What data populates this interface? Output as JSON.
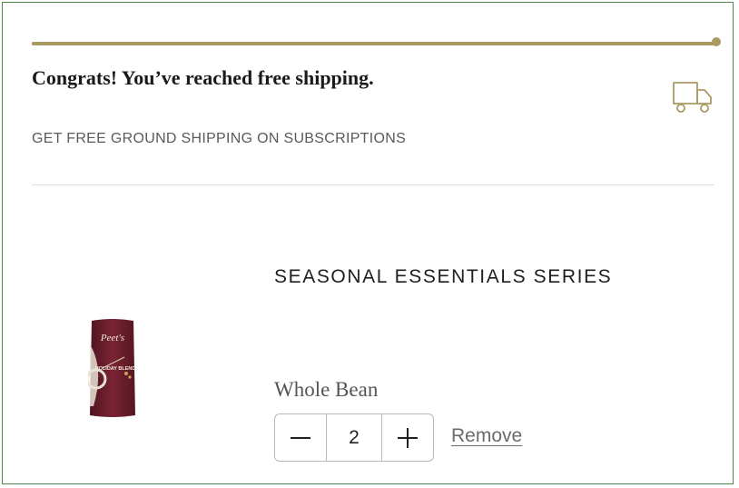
{
  "shipping": {
    "progress_fraction": 1.0,
    "congrats_text": "Congrats! You’ve reached free shipping.",
    "subtext": "GET FREE GROUND SHIPPING ON SUBSCRIPTIONS",
    "icon": "truck-icon",
    "accent_color": "#ab9a63"
  },
  "cart_item": {
    "title": "SEASONAL ESSENTIALS SERIES",
    "grind": "Whole Bean",
    "quantity": "2",
    "decrement_label": "−",
    "increment_label": "+",
    "remove_label": "Remove",
    "image": {
      "brand_text": "Peet's",
      "product_text": "HOLIDAY BLEND",
      "bag_color": "#6e1f2c"
    }
  }
}
